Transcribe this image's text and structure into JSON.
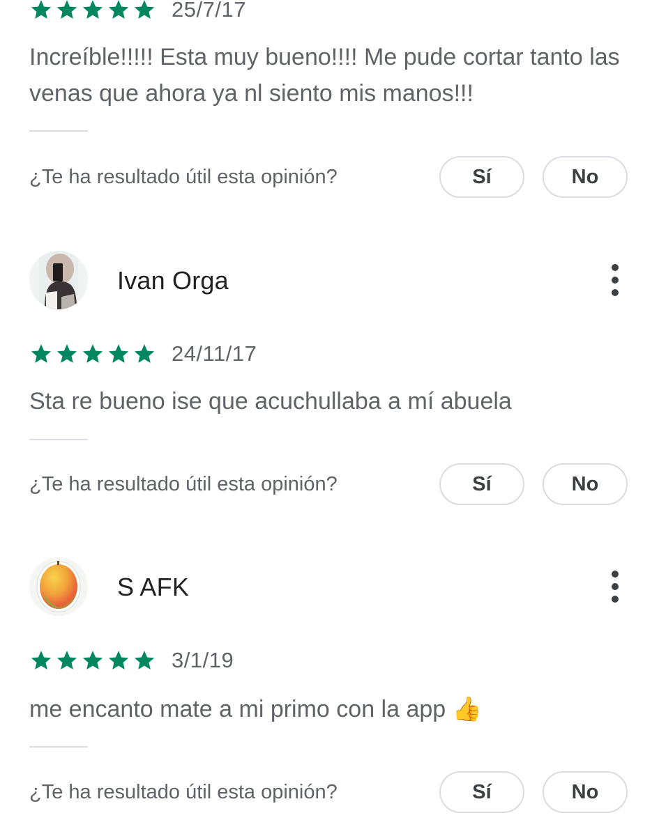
{
  "colors": {
    "star": "#01875f",
    "text_primary": "#202124",
    "text_secondary": "#5f6368",
    "border": "#dadce0"
  },
  "helpful": {
    "question": "¿Te ha resultado útil esta opinión?",
    "yes_label": "Sí",
    "no_label": "No"
  },
  "reviews": [
    {
      "rating": 5,
      "date": "25/7/17",
      "text": "Increíble!!!!! Esta muy bueno!!!! Me pude cortar tanto las venas que ahora ya nl siento mis manos!!!"
    },
    {
      "reviewer": "Ivan Orga",
      "avatar_icon": "profile-photo",
      "rating": 5,
      "date": "24/11/17",
      "text": "Sta re bueno ise que acuchullaba a mí abuela"
    },
    {
      "reviewer": "S AFK",
      "avatar_icon": "mango-icon",
      "rating": 5,
      "date": "3/1/19",
      "text": "me encanto mate a mi primo con la app 👍"
    }
  ]
}
